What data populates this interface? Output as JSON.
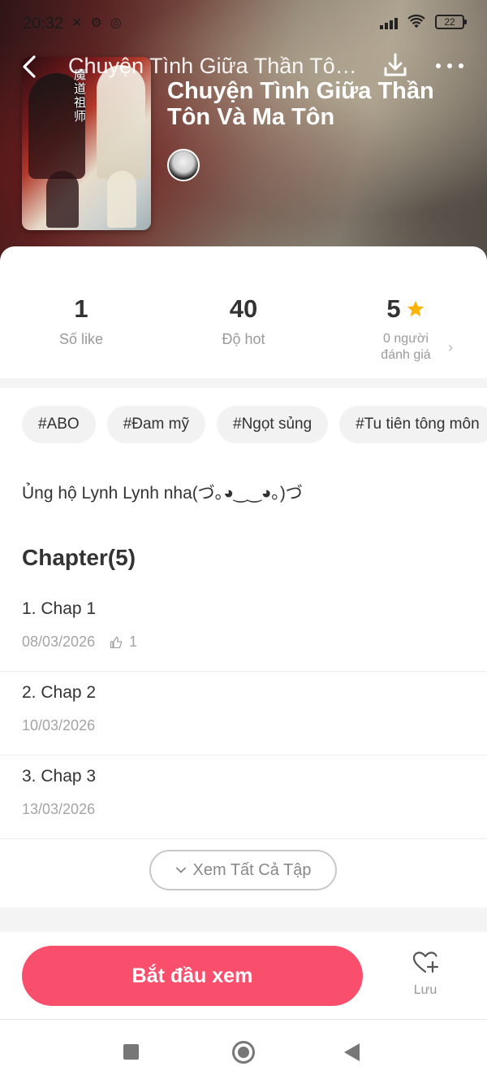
{
  "status_bar": {
    "time": "20:32",
    "battery": "22"
  },
  "header": {
    "title": "Chuyện Tình Giữa Thần Tôn Và Ma Tôn"
  },
  "book": {
    "title": "Chuyện Tình Giữa Thần Tôn Và Ma Tôn",
    "cover_text": "魔道祖师"
  },
  "stats": {
    "likes": {
      "value": "1",
      "label": "Số like"
    },
    "hot": {
      "value": "40",
      "label": "Độ hot"
    },
    "rating": {
      "value": "5",
      "label_line1": "0 người",
      "label_line2": "đánh giá"
    }
  },
  "tags": [
    "#ABO",
    "#Đam mỹ",
    "#Ngọt sủng",
    "#Tu tiên tông môn"
  ],
  "description": "Ủng hộ Lynh Lynh nha(づ｡◕‿‿◕｡)づ",
  "chapters": {
    "heading": "Chapter(5)",
    "items": [
      {
        "name": "1. Chap 1",
        "date": "08/03/2026",
        "likes": "1"
      },
      {
        "name": "2. Chap 2",
        "date": "10/03/2026"
      },
      {
        "name": "3. Chap 3",
        "date": "13/03/2026"
      }
    ],
    "see_all_label": "Xem Tất Cả Tập"
  },
  "actions": {
    "start_label": "Bắt đầu xem",
    "save_label": "Lưu"
  },
  "colors": {
    "accent": "#f94f6d",
    "star": "#ffb300"
  },
  "icons": {
    "back": "back-arrow-icon",
    "download": "download-icon",
    "more": "more-dots-icon",
    "star": "star-icon",
    "chevron_right": "chevron-right-icon",
    "thumb": "thumbs-up-icon",
    "chevron_down": "chevron-down-icon",
    "heart_add": "heart-plus-icon"
  }
}
